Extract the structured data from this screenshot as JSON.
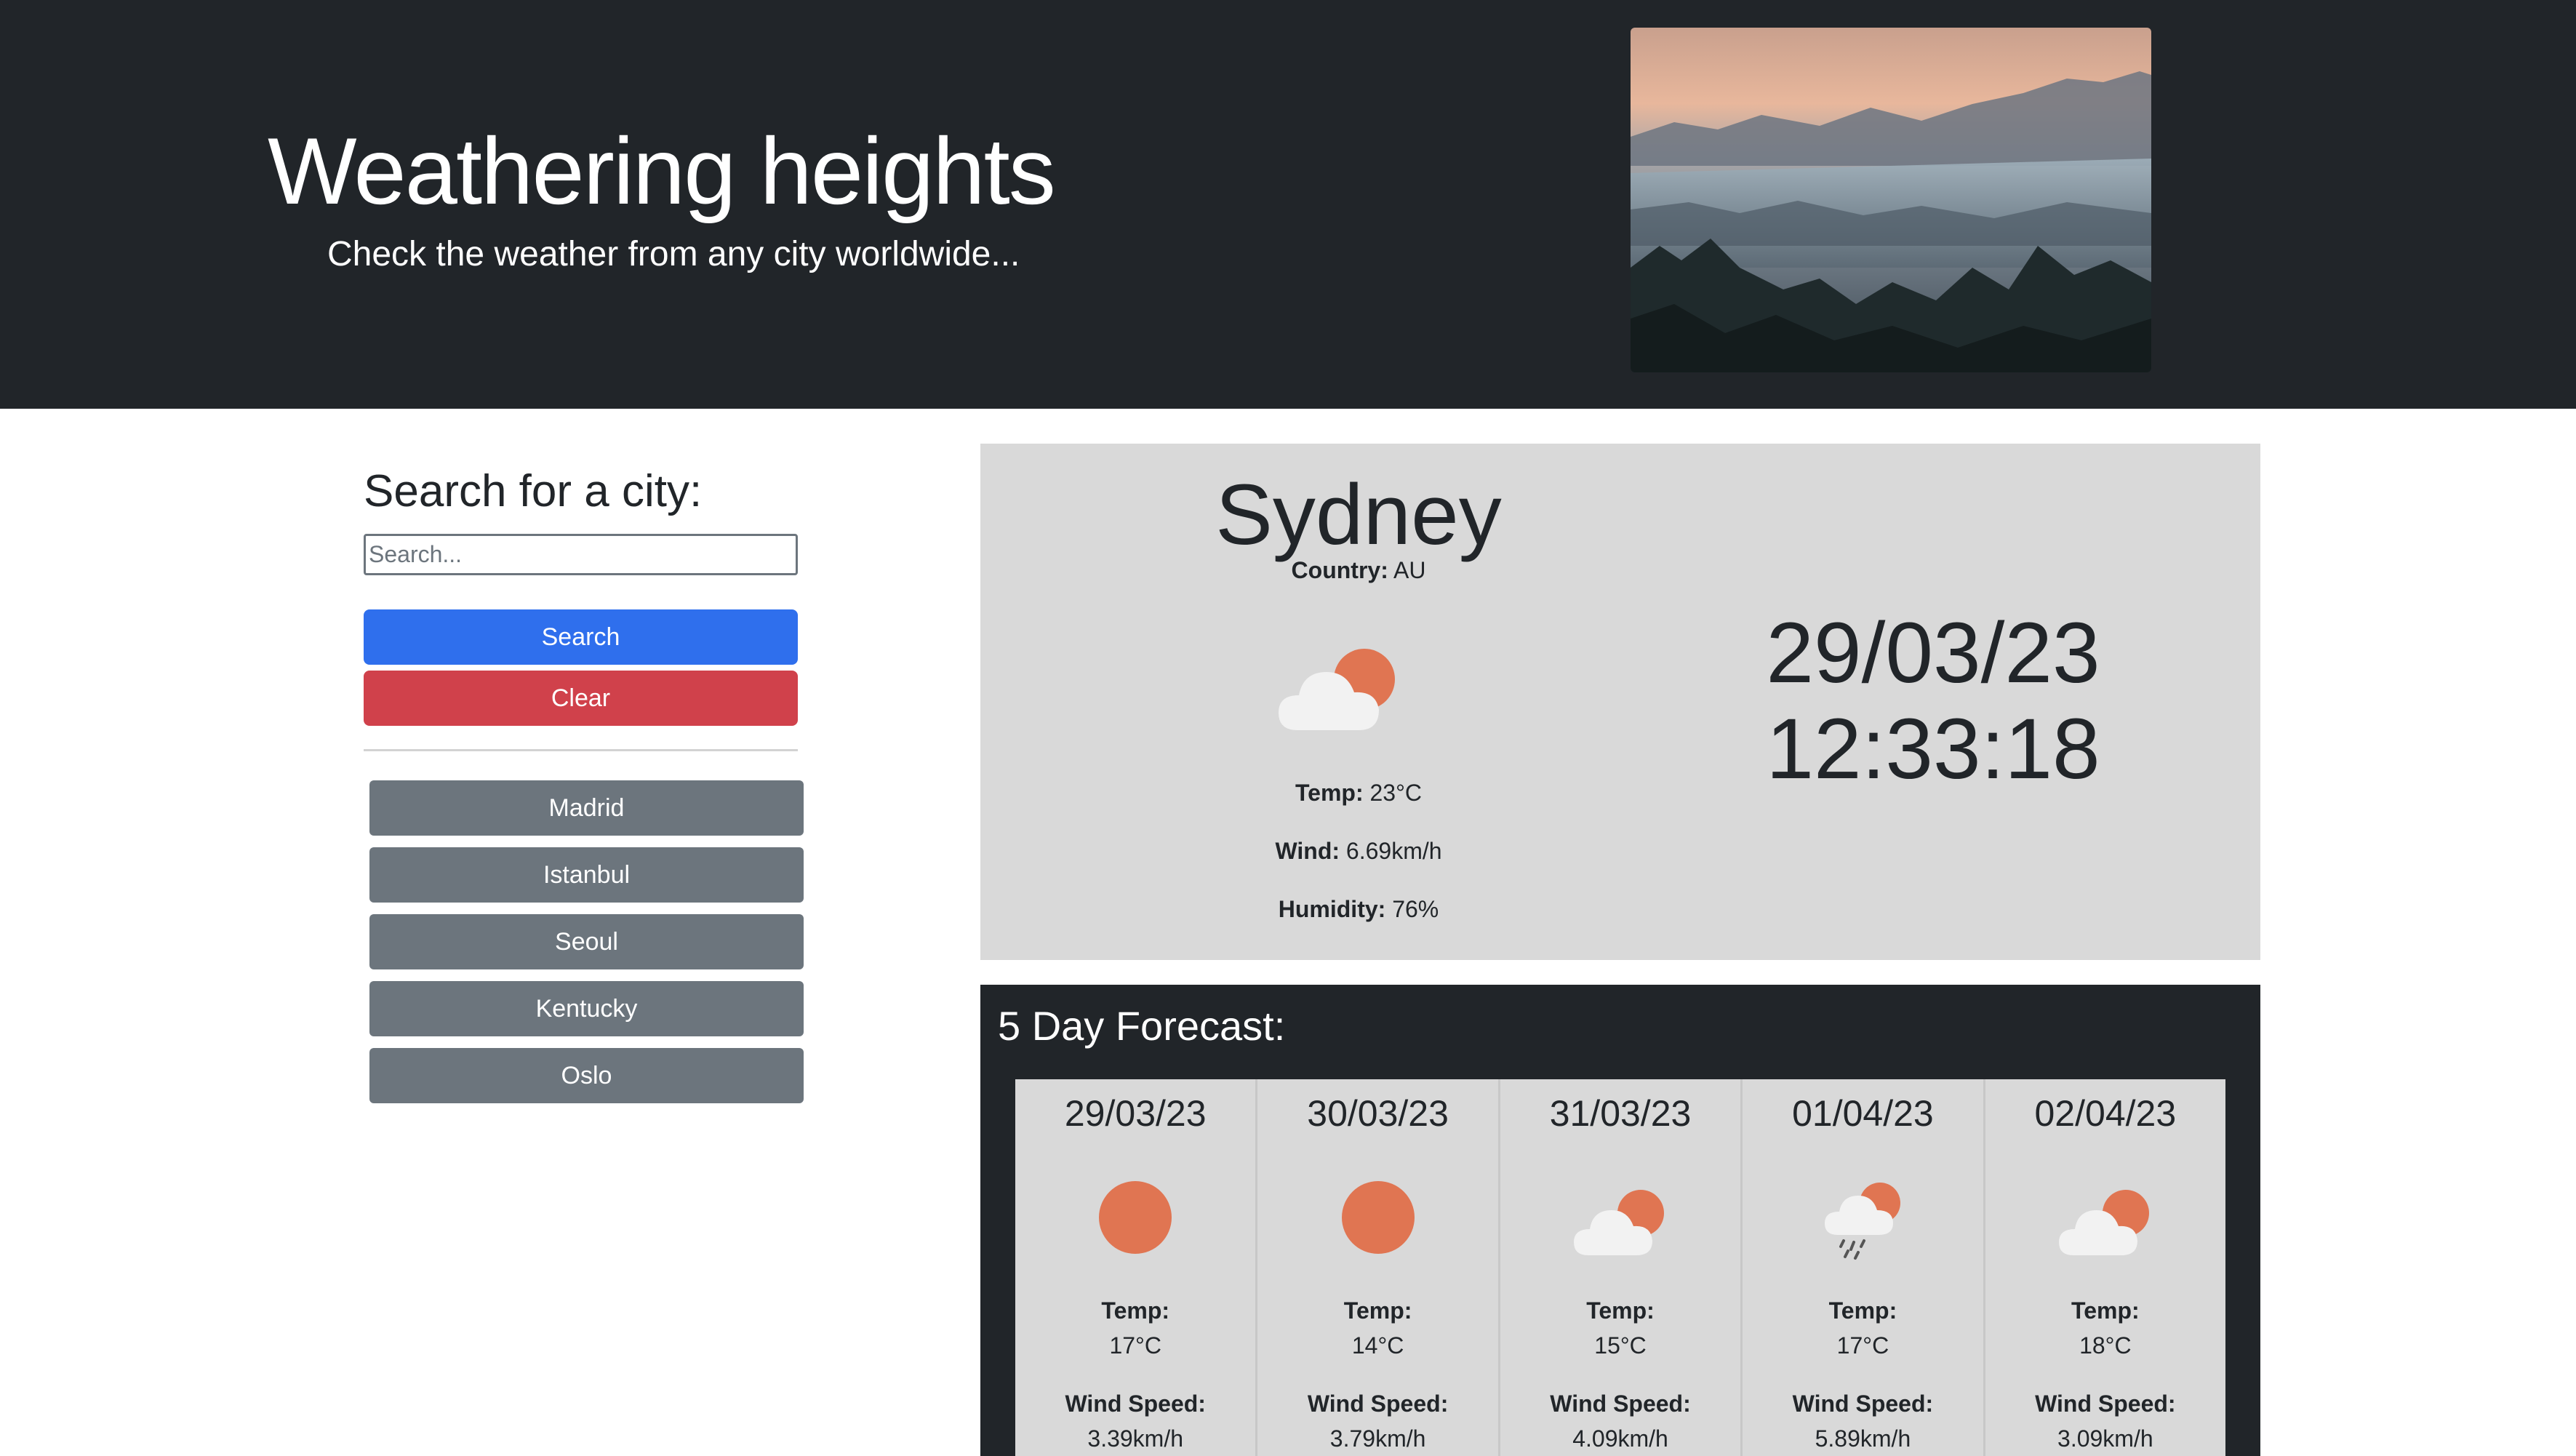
{
  "header": {
    "title": "Weathering heights",
    "tagline": "Check the weather from any city worldwide...",
    "image_icon": "mountain-fog-landscape-image"
  },
  "search": {
    "heading": "Search for a city:",
    "placeholder": "Search...",
    "value": "",
    "search_label": "Search",
    "clear_label": "Clear",
    "history": [
      "Madrid",
      "Istanbul",
      "Seoul",
      "Kentucky",
      "Oslo"
    ]
  },
  "current": {
    "city": "Sydney",
    "country_label": "Country:",
    "country": "AU",
    "icon": "partly-cloudy-icon",
    "temp_label": "Temp:",
    "temp": "23°C",
    "wind_label": "Wind:",
    "wind": "6.69km/h",
    "humidity_label": "Humidity:",
    "humidity": "76%",
    "date": "29/03/23",
    "time": "12:33:18"
  },
  "forecast": {
    "title": "5 Day Forecast:",
    "temp_label": "Temp:",
    "wind_label": "Wind Speed:",
    "days": [
      {
        "date": "29/03/23",
        "icon": "sun-icon",
        "temp": "17°C",
        "wind": "3.39km/h"
      },
      {
        "date": "30/03/23",
        "icon": "sun-icon",
        "temp": "14°C",
        "wind": "3.79km/h"
      },
      {
        "date": "31/03/23",
        "icon": "partly-cloudy-icon",
        "temp": "15°C",
        "wind": "4.09km/h"
      },
      {
        "date": "01/04/23",
        "icon": "rain-cloud-icon",
        "temp": "17°C",
        "wind": "5.89km/h"
      },
      {
        "date": "02/04/23",
        "icon": "partly-cloudy-icon",
        "temp": "18°C",
        "wind": "3.09km/h"
      }
    ]
  },
  "colors": {
    "header_bg": "#212529",
    "search_button": "#2f6fed",
    "clear_button": "#d0414b",
    "history_button": "#6c757d",
    "panel_bg": "#d9d9d9",
    "sun": "#e07552"
  }
}
